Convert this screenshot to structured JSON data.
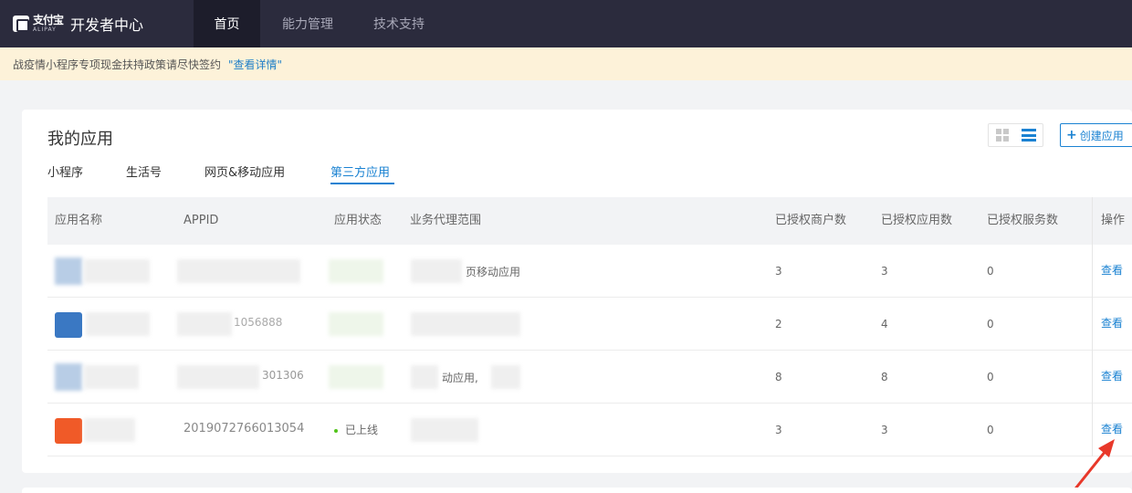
{
  "brand": {
    "logo_cn": "支付宝",
    "logo_en": "ALIPAY",
    "title": "开发者中心"
  },
  "nav": {
    "tabs": [
      {
        "label": "首页"
      },
      {
        "label": "能力管理"
      },
      {
        "label": "技术支持"
      }
    ]
  },
  "notice": {
    "text": "战疫情小程序专项现金扶持政策请尽快签约",
    "link": "\"查看详情\""
  },
  "card": {
    "title": "我的应用",
    "create_label": "创建应用",
    "subtabs": [
      {
        "label": "小程序"
      },
      {
        "label": "生活号"
      },
      {
        "label": "网页&移动应用"
      },
      {
        "label": "第三方应用"
      }
    ]
  },
  "table": {
    "columns": [
      "应用名称",
      "APPID",
      "应用状态",
      "业务代理范围",
      "已授权商户数",
      "已授权应用数",
      "已授权服务数",
      "操作"
    ],
    "rows": [
      {
        "appid": "",
        "status": "",
        "scope": "页移动应用",
        "merchants": "3",
        "apps": "3",
        "services": "0",
        "op": "查看"
      },
      {
        "appid": "1056888",
        "status": "",
        "scope": "",
        "merchants": "2",
        "apps": "4",
        "services": "0",
        "op": "查看"
      },
      {
        "appid": "301306",
        "status": "",
        "scope": "动应用,",
        "merchants": "8",
        "apps": "8",
        "services": "0",
        "op": "查看"
      },
      {
        "appid": "2019072766013054",
        "status": "已上线",
        "scope": "",
        "merchants": "3",
        "apps": "3",
        "services": "0",
        "op": "查看"
      }
    ]
  },
  "colors": {
    "accent": "#1a82d2",
    "nav_bg": "#2b2b3d",
    "notice_bg": "#fdf2d9",
    "arrow": "#e8382a"
  },
  "icons": [
    "alipay-logo-icon",
    "grid-view-icon",
    "list-view-icon",
    "plus-icon",
    "status-dot-icon",
    "red-arrow-annotation"
  ]
}
